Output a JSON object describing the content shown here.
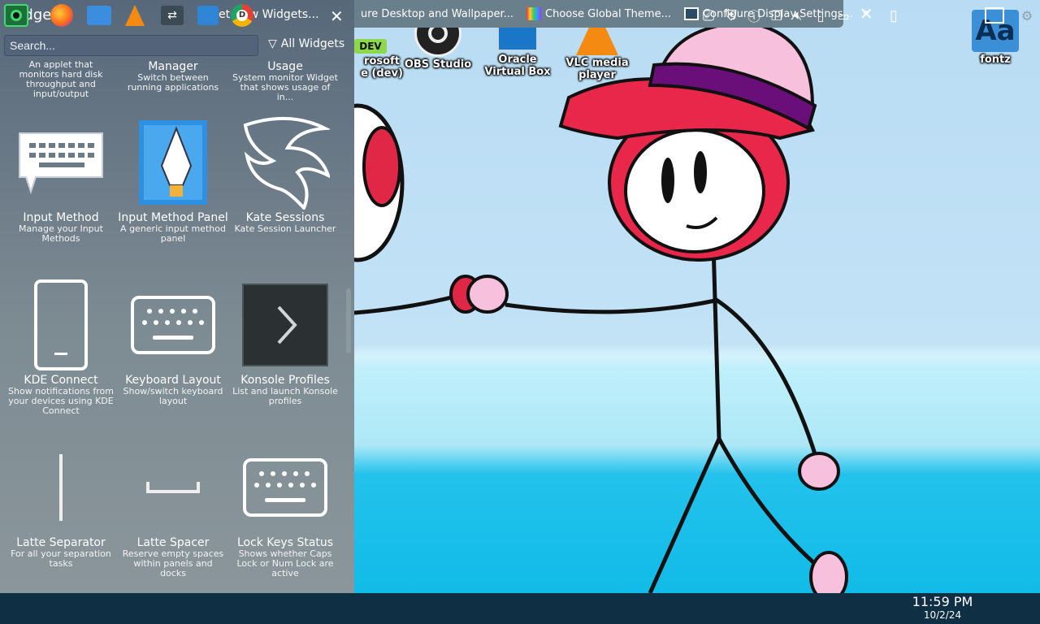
{
  "panel": {
    "title": "Widgets",
    "get_new_label": "Get New Widgets...",
    "search_placeholder": "Search...",
    "filter_label": "All Widgets"
  },
  "partial_top_row": [
    {
      "name": "",
      "desc": "An applet that monitors hard disk throughput and input/output"
    },
    {
      "name": "Manager",
      "desc": "Switch between running applications"
    },
    {
      "name": "Usage",
      "desc": "System monitor Widget that shows usage of in..."
    }
  ],
  "widgets": [
    {
      "name": "Input Method",
      "desc": "Manage your Input Methods",
      "icon": "keyboard-speech-icon"
    },
    {
      "name": "Input Method Panel",
      "desc": "A generic input method panel",
      "icon": "pen-nib-icon"
    },
    {
      "name": "Kate Sessions",
      "desc": "Kate Session Launcher",
      "icon": "kate-bird-icon"
    },
    {
      "name": "KDE Connect",
      "desc": "Show notifications from your devices using KDE Connect",
      "icon": "phone-icon"
    },
    {
      "name": "Keyboard Layout",
      "desc": "Show/switch keyboard layout",
      "icon": "keyboard-icon"
    },
    {
      "name": "Konsole Profiles",
      "desc": "List and launch Konsole profiles",
      "icon": "konsole-icon"
    },
    {
      "name": "Latte Separator",
      "desc": "For all your separation tasks",
      "icon": "separator-icon"
    },
    {
      "name": "Latte Spacer",
      "desc": "Reserve empty spaces within panels and docks",
      "icon": "spacer-icon"
    },
    {
      "name": "Lock Keys Status",
      "desc": "Shows whether Caps Lock or Num Lock are active",
      "icon": "keyboard-icon"
    }
  ],
  "window_tasks": [
    {
      "label": "ure Desktop and Wallpaper..."
    },
    {
      "label": "Choose Global Theme..."
    },
    {
      "label": "Configure Display Settings..."
    }
  ],
  "desktop_icons": [
    {
      "label": "rosoft\ne (dev)",
      "badge": "DEV"
    },
    {
      "label": "OBS Studio"
    },
    {
      "label": "Oracle Virtual Box"
    },
    {
      "label": "VLC media player"
    },
    {
      "label": "fontz"
    }
  ],
  "clock": {
    "time": "11:59 PM",
    "date": "10/2/24"
  },
  "colors": {
    "panel_bg": "#6f7f8a",
    "taskbar": "#0f2f44",
    "accent": "#3daee9"
  }
}
